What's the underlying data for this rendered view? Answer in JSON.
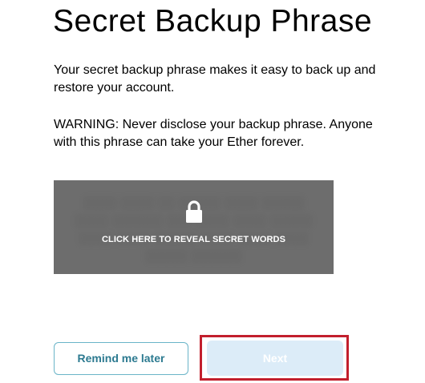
{
  "page": {
    "title": "Secret Backup Phrase",
    "description": "Your secret backup phrase makes it easy to back up and restore your account.",
    "warning": "WARNING: Never disclose your backup phrase. Anyone with this phrase can take your Ether forever."
  },
  "reveal": {
    "label": "CLICK HERE TO REVEAL SECRET WORDS",
    "icon": "lock-icon"
  },
  "buttons": {
    "remind_label": "Remind me later",
    "next_label": "Next",
    "next_disabled": true
  },
  "colors": {
    "reveal_bg": "#6d6d6d",
    "remind_border": "#6ab4c8",
    "remind_text": "#2c7a90",
    "next_bg": "#dcecf8",
    "highlight": "#c21f2d"
  }
}
